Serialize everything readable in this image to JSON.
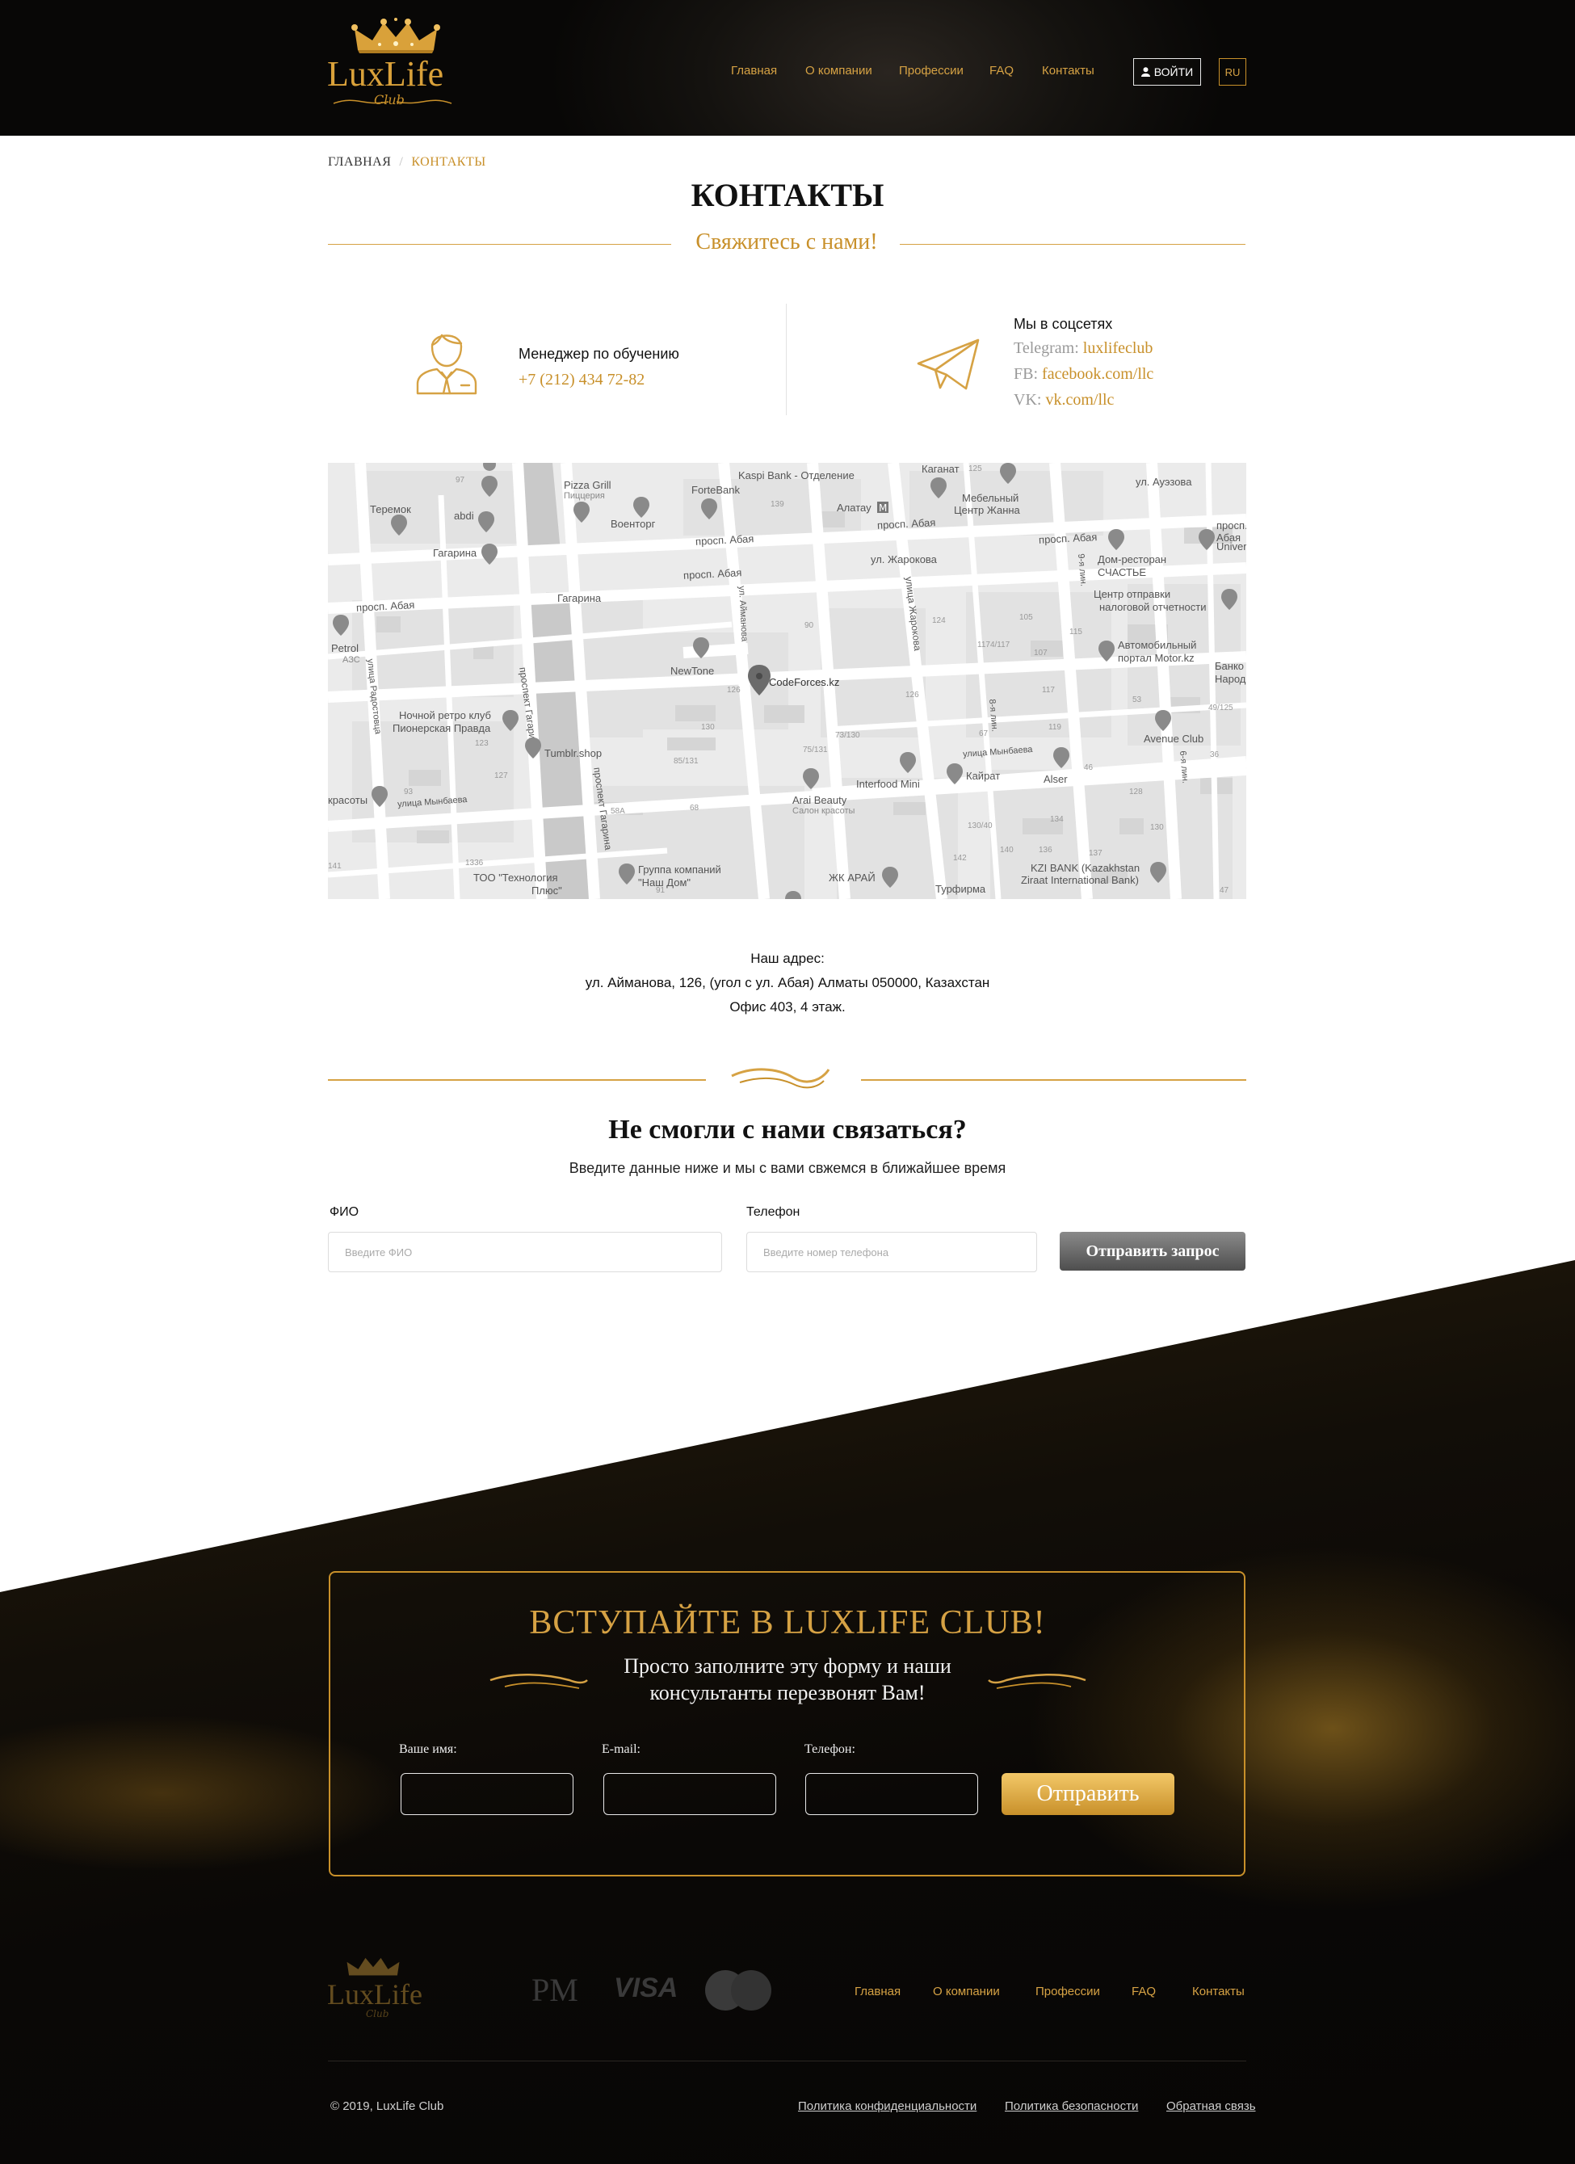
{
  "header": {
    "logo_text": "LuxLife",
    "logo_sub": "Club",
    "nav": [
      "Главная",
      "О компании",
      "Профессии",
      "FAQ",
      "Контакты"
    ],
    "login_label": "ВОЙТИ",
    "lang": "RU"
  },
  "breadcrumb": {
    "home": "ГЛАВНАЯ",
    "separator": "/",
    "current": "КОНТАКТЫ"
  },
  "page_title": "КОНТАКТЫ",
  "subtitle": "Свяжитесь с нами!",
  "manager": {
    "title": "Менеджер по обучению",
    "phone": "+7 (212) 434 72-82"
  },
  "social": {
    "title": "Мы в соцсетях",
    "telegram_label": "Telegram:",
    "telegram_value": "luxlifeclub",
    "fb_label": "FB:",
    "fb_value": "facebook.com/llc",
    "vk_label": "VK:",
    "vk_value": "vk.com/llc"
  },
  "map": {
    "labels": {
      "pizza": "Pizza Grill",
      "pizza_sub": "Пиццерия",
      "forte": "ForteBank",
      "kaspi": "Kaspi Bank - Отделение",
      "kaganat": "Каганат",
      "mebel": "Мебельный",
      "mebel2": "Центр Жанна",
      "auezov": "ул. Ауэзова",
      "teremok": "Теремок",
      "abdi": "abdi",
      "voentorg": "Военторг",
      "almatau": "Алатау",
      "abaya1": "просп. Абая",
      "abaya2": "просп. Абая",
      "abaya3": "просп. Абая",
      "abaya4": "просп. Абая",
      "abaya5": "просп. Абая",
      "abaya6": "просп. Абая",
      "gagarina1": "Гагарина",
      "gagarina2": "Гагарина",
      "zharokova": "ул. Жарокова",
      "dom": "Дом-ресторан",
      "dom2": "СЧАСТЬЕ",
      "center": "Центр отправки",
      "center2": "налоговой отчетности",
      "univ": "Univer",
      "avto": "Автомобильный",
      "avto2": "портал Motor.kz",
      "bank": "Банко",
      "bank2": "Народ",
      "petrol": "Petrol",
      "petrol_sub": "АЗС",
      "newtone": "NewTone",
      "codeforces": "CodeForces.kz",
      "nochnoy": "Ночной ретро клуб",
      "nochnoy2": "Пионерская Правда",
      "tumblr": "Tumblr.shop",
      "interfood": "Interfood Mini",
      "kayrat": "Кайрат",
      "alser": "Alser",
      "avenue": "Avenue Club",
      "arai": "Arai Beauty",
      "arai_sub": "Салон красоты",
      "krasoty": "красоты",
      "mynbaeva1": "улица Мынбаева",
      "mynbaeva2": "улица Мынбаева",
      "too": "ТОО \"Технология",
      "too2": "Плюс\"",
      "gruppa": "Группа компаний",
      "gruppa2": "\"Наш Дом\"",
      "zhk": "ЖК АРАЙ",
      "kzi": "KZI BANK (Kazakhstan",
      "kzi2": "Ziraat International Bank)",
      "turfirma": "Турфирма",
      "gagarina_v1": "проспект Гагарина",
      "gagarina_v2": "проспект Гагарина",
      "aymanova": "ул. Айманова",
      "zharokova_v": "улица Жарокова",
      "radostovtsa": "улица Радостовца",
      "line8": "8-я лин.",
      "line9": "9-я лин.",
      "line6": "6-я лин.",
      "n90": "90",
      "n126": "126",
      "n126b": "126",
      "n130": "130",
      "n131": "75/131",
      "n85": "85/131",
      "n68": "68",
      "n58": "58А",
      "n93": "93",
      "n123": "123",
      "n127": "127",
      "n105": "105",
      "n115": "115",
      "n117": "117",
      "n107": "107",
      "n1174": "1174/117",
      "n119": "119",
      "n67": "67",
      "n46": "46",
      "n36": "36",
      "n128": "128",
      "n130b": "130",
      "n134": "134",
      "n136": "136",
      "n137": "137",
      "n140": "140",
      "n142": "142",
      "n13040": "130/40",
      "n49125": "49/125",
      "n53": "53",
      "n47": "47",
      "n141": "141",
      "n1336": "1336",
      "n125": "125",
      "n139": "139",
      "n124": "124",
      "n73130": "73/130",
      "n97": "97",
      "n91": "91"
    }
  },
  "address": {
    "label": "Наш адрес:",
    "line1": "ул. Айманова, 126, (угол с ул. Абая) Алматы 050000, Казахстан",
    "line2": "Офис 403, 4 этаж."
  },
  "callback": {
    "title": "Не смогли с нами связаться?",
    "subtitle": "Введите данные ниже и мы с вами свжемся в ближайшее время",
    "fio_label": "ФИО",
    "fio_placeholder": "Введите ФИО",
    "phone_label": "Телефон",
    "phone_placeholder": "Введите номер телефона",
    "submit": "Отправить запрос"
  },
  "join": {
    "title": "ВСТУПАЙТЕ В LUXLIFE CLUB!",
    "subtitle_line1": "Просто заполните эту форму и наши",
    "subtitle_line2": "консультанты перезвонят Вам!",
    "name_label": "Ваше имя:",
    "email_label": "E-mail:",
    "phone_label": "Телефон:",
    "submit": "Отправить"
  },
  "footer": {
    "logo_text": "LuxLife",
    "logo_sub": "Club",
    "pm": "PM",
    "visa": "VISA",
    "nav": [
      "Главная",
      "О компании",
      "Профессии",
      "FAQ",
      "Контакты"
    ],
    "copyright": "© 2019, LuxLife Club",
    "links": [
      "Политика конфиденциальности",
      "Политика безопасности",
      "Обратная связь"
    ]
  },
  "colors": {
    "gold": "#c8902a",
    "gold_light": "#d6a244",
    "dark": "#0a0806"
  }
}
